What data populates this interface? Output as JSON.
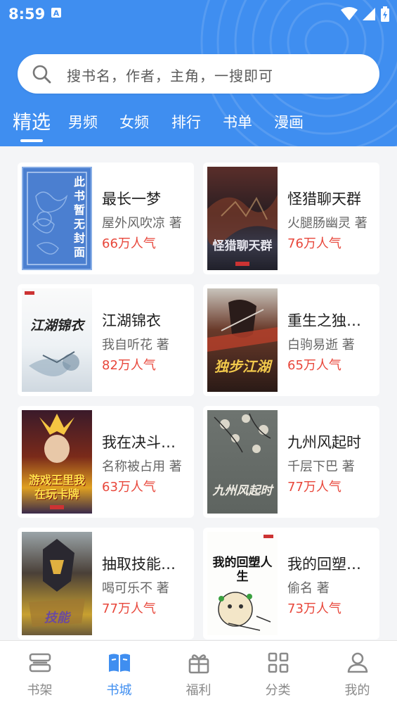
{
  "status": {
    "time": "8:59"
  },
  "search": {
    "placeholder": "搜书名，作者，主角，一搜即可"
  },
  "tabs": [
    "精选",
    "男频",
    "女频",
    "排行",
    "书单",
    "漫画"
  ],
  "active_tab": "精选",
  "books": [
    {
      "title": "最长一梦",
      "author": "屋外风吹凉 著",
      "popularity": "66万人气",
      "cover_text": "此书暂无封面"
    },
    {
      "title": "怪猎聊天群",
      "author": "火腿肠幽灵 著",
      "popularity": "76万人气",
      "cover_text": "怪猎聊天群"
    },
    {
      "title": "江湖锦衣",
      "author": "我自听花 著",
      "popularity": "82万人气",
      "cover_text": "江湖锦衣"
    },
    {
      "title": "重生之独步…",
      "author": "白驹易逝 著",
      "popularity": "65万人气",
      "cover_text": "独步江湖"
    },
    {
      "title": "我在决斗都…",
      "author": "名称被占用 著",
      "popularity": "63万人气",
      "cover_text": "游戏王里我在玩卡牌"
    },
    {
      "title": "九州风起时",
      "author": "千层下巴 著",
      "popularity": "77万人气",
      "cover_text": "九州风起时"
    },
    {
      "title": "抽取技能，…",
      "author": "喝可乐不 著",
      "popularity": "77万人气",
      "cover_text": "技能"
    },
    {
      "title": "我的回塑人…",
      "author": "偷名 著",
      "popularity": "73万人气",
      "cover_text": "我的回塑人生"
    }
  ],
  "nav": [
    {
      "label": "书架",
      "icon": "bookshelf-icon"
    },
    {
      "label": "书城",
      "icon": "book-open-icon"
    },
    {
      "label": "福利",
      "icon": "gift-icon"
    },
    {
      "label": "分类",
      "icon": "grid-icon"
    },
    {
      "label": "我的",
      "icon": "user-icon"
    }
  ],
  "active_nav": "书城",
  "colors": {
    "primary": "#3f8ef0",
    "popularity": "#e8473b",
    "background": "#f4f5f7"
  }
}
